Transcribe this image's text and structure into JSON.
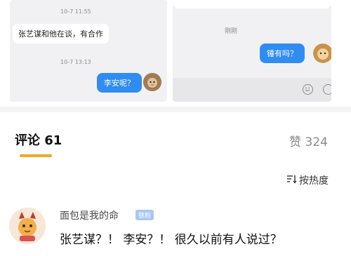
{
  "left_chat": {
    "time1": "10-7 11:55",
    "message_in": "张艺谋和他在谈，有合作",
    "time2": "10-7 13:13",
    "message_out": "李安呢？"
  },
  "right_chat": {
    "time": "刚刚",
    "message_out": "锤有吗？"
  },
  "tabs": {
    "comments_label": "评论 61",
    "likes_label": "赞 324"
  },
  "sort": {
    "label": "按热度"
  },
  "comment": {
    "username": "面包是我的命",
    "badge": "铁粉",
    "text": "张艺谋？！ 李安？！ 很久以前有人说过？"
  },
  "colors": {
    "accent_underline": "#f5a623",
    "bubble_blue": "#2f8cf2",
    "badge_blue": "#a9c7ef"
  }
}
